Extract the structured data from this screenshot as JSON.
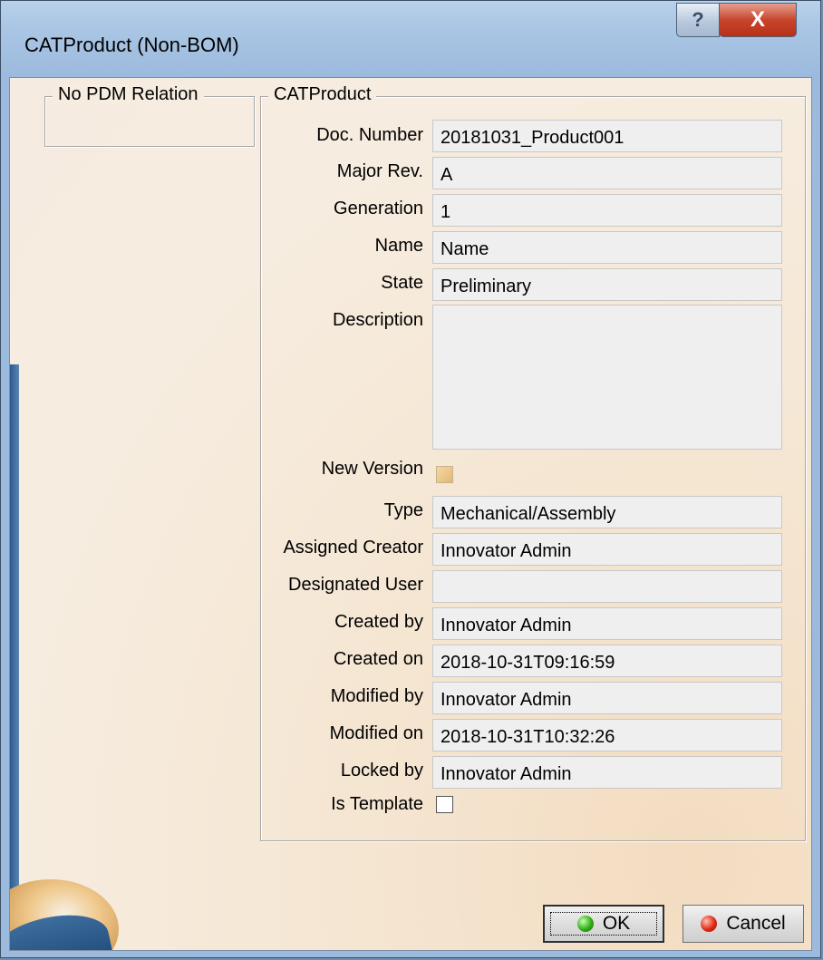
{
  "window": {
    "title": "CATProduct (Non-BOM)",
    "help_glyph": "?",
    "close_glyph": "X"
  },
  "groups": {
    "pdm_relation_title": "No PDM Relation",
    "catproduct_title": "CATProduct"
  },
  "fields": {
    "doc_number": {
      "label": "Doc. Number",
      "value": "20181031_Product001"
    },
    "major_rev": {
      "label": "Major Rev.",
      "value": "A"
    },
    "generation": {
      "label": "Generation",
      "value": "1"
    },
    "name": {
      "label": "Name",
      "value": "Name"
    },
    "state": {
      "label": "State",
      "value": "Preliminary"
    },
    "description": {
      "label": "Description",
      "value": ""
    },
    "new_version": {
      "label": "New Version",
      "checked": false,
      "enabled": false
    },
    "type": {
      "label": "Type",
      "value": "Mechanical/Assembly"
    },
    "assigned_creator": {
      "label": "Assigned Creator",
      "value": "Innovator Admin"
    },
    "designated_user": {
      "label": "Designated User",
      "value": ""
    },
    "created_by": {
      "label": "Created by",
      "value": "Innovator Admin"
    },
    "created_on": {
      "label": "Created on",
      "value": "2018-10-31T09:16:59"
    },
    "modified_by": {
      "label": "Modified by",
      "value": "Innovator Admin"
    },
    "modified_on": {
      "label": "Modified on",
      "value": "2018-10-31T10:32:26"
    },
    "locked_by": {
      "label": "Locked by",
      "value": "Innovator Admin"
    },
    "is_template": {
      "label": "Is Template",
      "checked": false,
      "enabled": true
    }
  },
  "buttons": {
    "ok_label": "OK",
    "cancel_label": "Cancel"
  },
  "colors": {
    "ok_icon": "#2fae16",
    "cancel_icon": "#e02a16",
    "close_button": "#c7452c"
  },
  "icons": {
    "help": "help-icon",
    "close": "close-icon",
    "ok": "green-ball-icon",
    "cancel": "red-ball-icon"
  }
}
